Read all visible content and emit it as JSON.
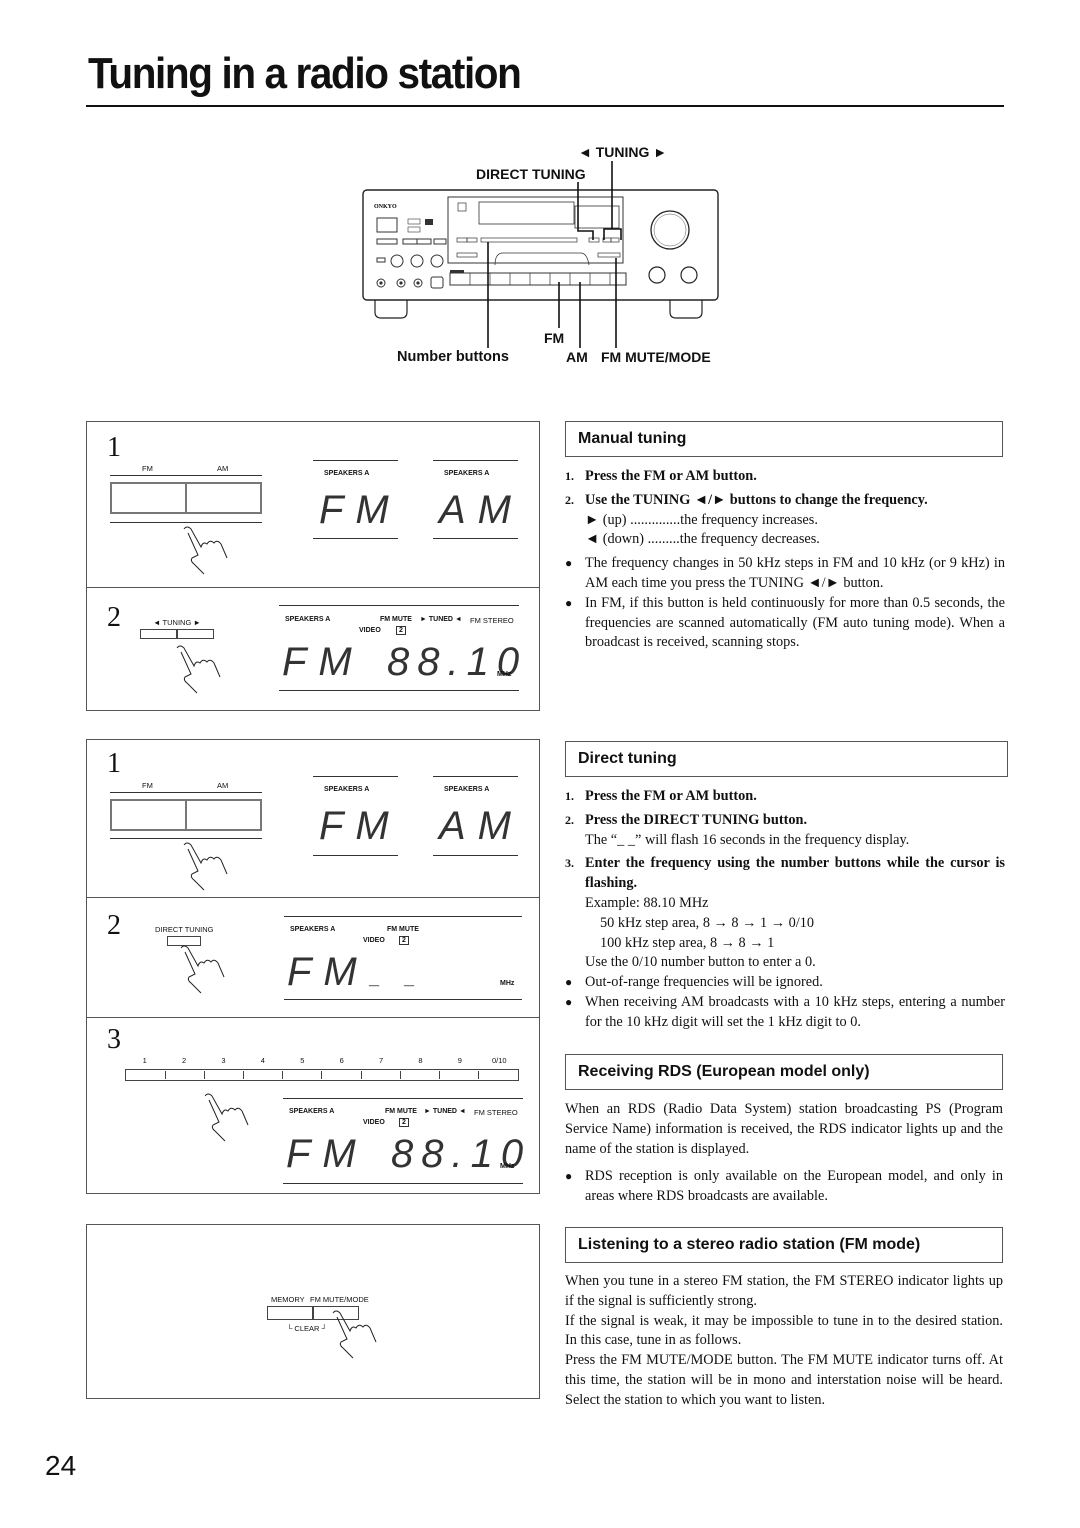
{
  "page": {
    "title": "Tuning in a radio station",
    "page_number": "24"
  },
  "receiver_figure": {
    "brand": "ONKYO",
    "callouts": {
      "tuning": "◄ TUNING ►",
      "direct_tuning": "DIRECT TUNING",
      "fm": "FM",
      "number_buttons": "Number buttons",
      "am": "AM",
      "fm_mute_mode": "FM MUTE/MODE"
    }
  },
  "manual_figure": {
    "step1": {
      "num": "1",
      "button_labels": [
        "FM",
        "AM"
      ],
      "displays": [
        {
          "indicator": "SPEAKERS A",
          "text": "FM"
        },
        {
          "indicator": "SPEAKERS A",
          "text": "AM"
        }
      ]
    },
    "step2": {
      "num": "2",
      "button_label": "TUNING",
      "indicators": {
        "speakers": "SPEAKERS A",
        "fm_mute": "FM MUTE",
        "tuned": "► TUNED ◄",
        "fm_stereo": "FM STEREO",
        "video": "VIDEO",
        "video_num": "2"
      },
      "band": "FM",
      "frequency": "88.10",
      "unit": "MHz"
    }
  },
  "direct_figure": {
    "step1": {
      "num": "1",
      "button_labels": [
        "FM",
        "AM"
      ],
      "displays": [
        {
          "indicator": "SPEAKERS A",
          "text": "FM"
        },
        {
          "indicator": "SPEAKERS A",
          "text": "AM"
        }
      ]
    },
    "step2": {
      "num": "2",
      "button_label": "DIRECT TUNING",
      "indicators": {
        "speakers": "SPEAKERS A",
        "fm_mute": "FM MUTE",
        "video": "VIDEO",
        "video_num": "2"
      },
      "band": "FM",
      "frequency": "_ _",
      "unit": "MHz"
    },
    "step3": {
      "num": "3",
      "number_buttons": [
        "1",
        "2",
        "3",
        "4",
        "5",
        "6",
        "7",
        "8",
        "9",
        "0/10"
      ],
      "indicators": {
        "speakers": "SPEAKERS A",
        "fm_mute": "FM MUTE",
        "tuned": "► TUNED ◄",
        "fm_stereo": "FM STEREO",
        "video": "VIDEO",
        "video_num": "2"
      },
      "band": "FM",
      "frequency": "88.10",
      "unit": "MHz"
    }
  },
  "mode_figure": {
    "labels": [
      "MEMORY",
      "FM MUTE/MODE"
    ],
    "clear": "CLEAR"
  },
  "manual_tuning": {
    "heading": "Manual tuning",
    "steps": [
      {
        "num": "1.",
        "text": "Press the FM or AM button."
      },
      {
        "num": "2.",
        "text": "Use the TUNING ◄/► buttons to change the frequency."
      }
    ],
    "sub": [
      "► (up) ..............the frequency increases.",
      "◄ (down) .........the frequency decreases."
    ],
    "bullets": [
      "The frequency changes in 50 kHz steps in FM and 10 kHz (or 9 kHz) in AM each time you press the TUNING ◄/► button.",
      "In FM, if this button is held continuously for more than 0.5 seconds, the frequencies are scanned automatically (FM auto tuning mode). When a broadcast is received, scanning stops."
    ]
  },
  "direct_tuning": {
    "heading": "Direct tuning",
    "step1": {
      "num": "1.",
      "text": "Press the FM or AM button."
    },
    "step2": {
      "num": "2.",
      "text": "Press the DIRECT TUNING button.",
      "note": "The “_ _” will flash 16 seconds in the frequency display."
    },
    "step3": {
      "num": "3.",
      "text": "Enter the frequency using the number buttons while the cursor is flashing.",
      "example": "Example: 88.10 MHz",
      "ex1": "50 kHz step area, 8 → 8 → 1 → 0/10",
      "ex2": "100 kHz step area, 8 → 8 → 1",
      "note": "Use the 0/10 number button to enter a 0."
    },
    "bullets": [
      "Out-of-range frequencies will be ignored.",
      "When receiving AM broadcasts with a 10 kHz steps, entering a number for the 10 kHz digit will set the 1 kHz digit to 0."
    ]
  },
  "rds": {
    "heading": "Receiving RDS (European model only)",
    "body": "When an RDS (Radio Data System) station broadcasting PS (Program Service Name) information is received, the RDS indicator lights up and the name of the station is displayed.",
    "bullets": [
      "RDS reception is only available on the European model, and only in areas where RDS broadcasts are available."
    ]
  },
  "fm_mode": {
    "heading": "Listening to a stereo radio station (FM mode)",
    "p1": "When you tune in a stereo FM station, the FM STEREO indicator lights up if the signal is sufficiently strong.",
    "p2": "If the signal is weak, it may be impossible to tune in to the desired station. In this case, tune in as follows.",
    "p3": "Press the FM MUTE/MODE button. The FM MUTE indicator turns off. At this time, the station will be in mono and interstation noise will be heard. Select the station to which you want to listen."
  }
}
